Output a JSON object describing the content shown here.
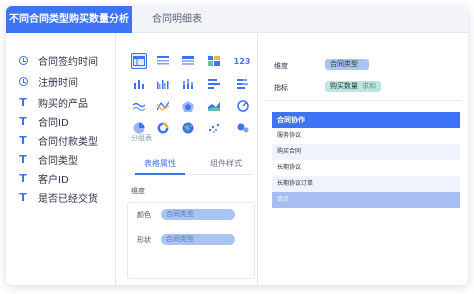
{
  "tabs": [
    {
      "label": "不同合同类型购买数量分析"
    },
    {
      "label": "合同明细表"
    }
  ],
  "fields": [
    {
      "label": "合同签约时间",
      "icon": "clock-icon"
    },
    {
      "label": "注册时间",
      "icon": "clock-icon"
    },
    {
      "label": "购买的产品",
      "icon": "text-field-icon",
      "glyph": "T"
    },
    {
      "label": "合同ID",
      "icon": "text-field-icon",
      "glyph": "T"
    },
    {
      "label": "合同付款类型",
      "icon": "text-field-icon",
      "glyph": "T"
    },
    {
      "label": "合同类型",
      "icon": "text-field-icon",
      "glyph": "T"
    },
    {
      "label": "客户ID",
      "icon": "text-field-icon",
      "glyph": "T"
    },
    {
      "label": "是否已经交货",
      "icon": "text-field-icon",
      "glyph": "T"
    }
  ],
  "chart_types": {
    "selected_label": "分组表",
    "number_icon_text": "123",
    "icons": [
      "group-table-icon",
      "detail-table-icon",
      "crosstab-icon",
      "heatmap-table-icon",
      "kpi-number-icon",
      "bar-chart-icon",
      "grouped-bar-icon",
      "stacked-column-icon",
      "horizontal-bar-icon",
      "stacked-bar-icon",
      "line-chart-icon",
      "combo-chart-icon",
      "radar-chart-icon",
      "area-chart-icon",
      "gauge-icon",
      "pie-chart-icon",
      "donut-chart-icon",
      "map-icon",
      "scatter-chart-icon",
      "bubble-chart-icon"
    ]
  },
  "properties": {
    "tabs": [
      {
        "label": "表格属性"
      },
      {
        "label": "组件样式"
      }
    ],
    "dimension_label": "维度",
    "color_label": "颜色",
    "color_value": "合同类型",
    "shape_label": "形状",
    "shape_value": "合同类型"
  },
  "config": {
    "dimension_label": "维度",
    "dimension_value": "合同类型",
    "metric_label": "指标",
    "metric_value": "购买数量",
    "metric_agg": "求和"
  },
  "table": {
    "header": "合同协作",
    "rows": [
      "服务协议",
      "购买合同",
      "长期协议",
      "长期协议订单"
    ],
    "total": "合计"
  },
  "colors": {
    "accent": "#3d73f5",
    "pill_blue": "#a9c4f4",
    "pill_green": "#b9e8df"
  }
}
